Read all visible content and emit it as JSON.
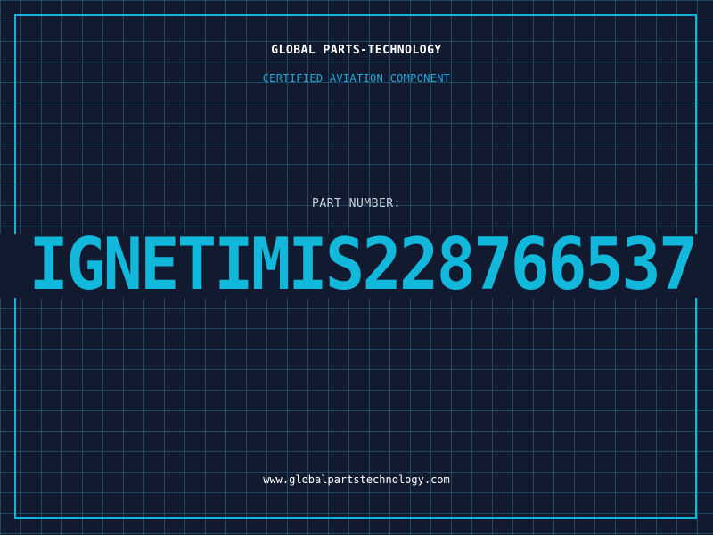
{
  "header": {
    "company_name": "GLOBAL PARTS-TECHNOLOGY",
    "tagline": "CERTIFIED AVIATION COMPONENT"
  },
  "part": {
    "label": "PART NUMBER:",
    "number": "IGNETIMIS228766537"
  },
  "footer": {
    "website": "www.globalpartstechnology.com"
  },
  "colors": {
    "background": "#111a2e",
    "accent": "#14b4d8",
    "grid": "#286e8c",
    "text": "#ffffff"
  }
}
